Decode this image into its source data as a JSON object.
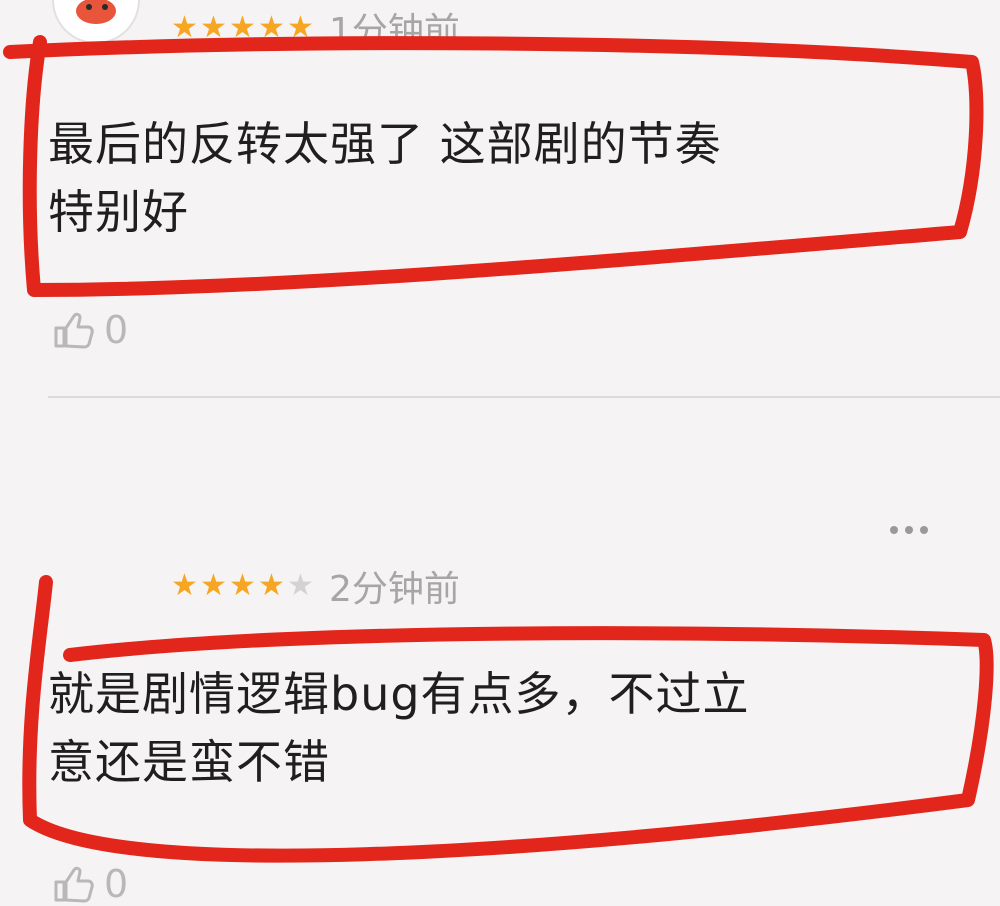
{
  "reviews": [
    {
      "stars_total": 5,
      "stars_filled": 5,
      "time": "1分钟前",
      "text_line1": "最后的反转太强了 这部剧的节奏",
      "text_line2": "特别好",
      "likes": "0"
    },
    {
      "stars_total": 5,
      "stars_filled": 4,
      "time": "2分钟前",
      "text_line1": "就是剧情逻辑bug有点多，不过立",
      "text_line2": "意还是蛮不错",
      "likes": "0"
    }
  ],
  "icons": {
    "star": "star-icon",
    "like": "thumbs-up-icon",
    "more": "more-options-icon"
  },
  "colors": {
    "background": "#f5f3f3",
    "star_filled": "#f6a622",
    "star_empty": "#d4d2d2",
    "annotation": "#e2261c",
    "text": "#1f1f1f",
    "muted": "#a7a5a5"
  }
}
